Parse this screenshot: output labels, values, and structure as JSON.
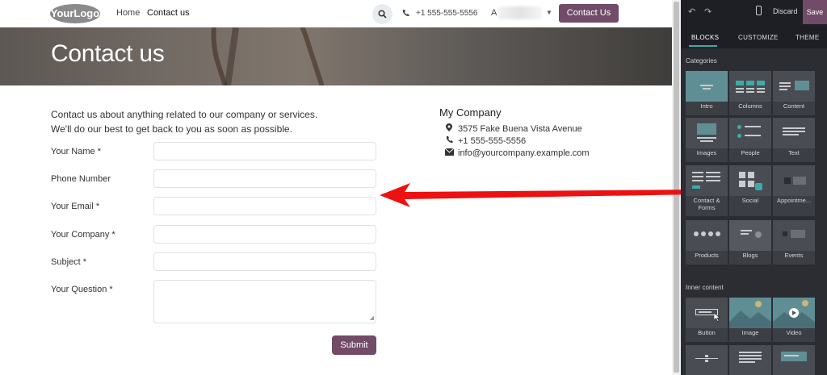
{
  "site": {
    "logo_text": "YourLogo",
    "nav": {
      "home": "Home",
      "contact": "Contact us"
    },
    "phone": "+1 555-555-5556",
    "user_initial": "A",
    "contact_button": "Contact Us",
    "hero_title": "Contact us",
    "intro_line1": "Contact us about anything related to our company or services.",
    "intro_line2": "We'll do our best to get back to you as soon as possible.",
    "form": {
      "fields": [
        {
          "label": "Your Name",
          "required": "*"
        },
        {
          "label": "Phone Number",
          "required": ""
        },
        {
          "label": "Your Email",
          "required": "*"
        },
        {
          "label": "Your Company",
          "required": "*"
        },
        {
          "label": "Subject",
          "required": "*"
        },
        {
          "label": "Your Question",
          "required": "*"
        }
      ],
      "submit": "Submit"
    },
    "company": {
      "name": "My Company",
      "address": "3575 Fake Buena Vista Avenue",
      "phone": "+1 555-555-5556",
      "email": "info@yourcompany.example.com"
    }
  },
  "editor": {
    "discard": "Discard",
    "save": "Save",
    "tabs": [
      "BLOCKS",
      "CUSTOMIZE",
      "THEME"
    ],
    "active_tab": "BLOCKS",
    "categories_title": "Categories",
    "categories": [
      "Intro",
      "Columns",
      "Content",
      "Images",
      "People",
      "Text",
      "Contact &",
      "Forms",
      "Social",
      "Appointme...",
      "Products",
      "Blogs",
      "Events"
    ],
    "inner_title": "Inner content",
    "inner": [
      "Button",
      "Image",
      "Video"
    ]
  },
  "colors": {
    "brand": "#714b67",
    "panel": "#2b2d33",
    "accent": "#3aadaa",
    "annotation": "#ee1111"
  }
}
